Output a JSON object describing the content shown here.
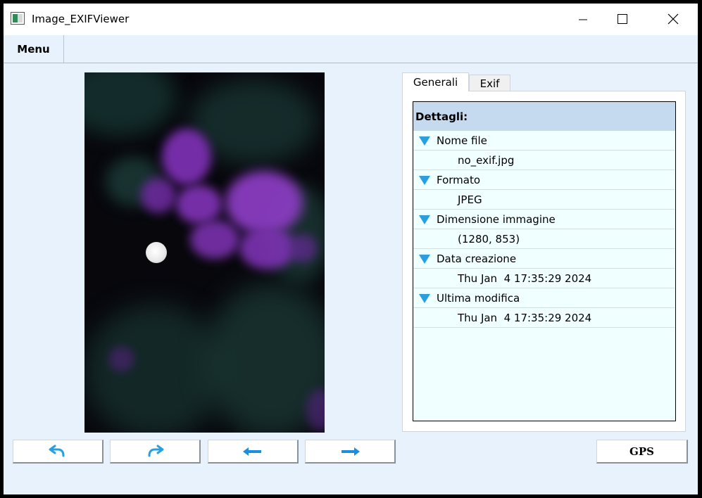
{
  "window": {
    "title": "Image_EXIFViewer"
  },
  "menubar": {
    "menu_label": "Menu"
  },
  "tabs": [
    {
      "label": "Generali"
    },
    {
      "label": "Exif"
    }
  ],
  "details": {
    "header": "Dettagli:",
    "items": [
      {
        "label": "Nome file",
        "value": "no_exif.jpg"
      },
      {
        "label": "Formato",
        "value": "JPEG"
      },
      {
        "label": "Dimensione immagine",
        "value": "(1280, 853)"
      },
      {
        "label": "Data creazione",
        "value": "Thu Jan  4 17:35:29 2024"
      },
      {
        "label": "Ultima modifica",
        "value": "Thu Jan  4 17:35:29 2024"
      }
    ]
  },
  "buttons": {
    "gps_label": "GPS"
  },
  "icons": {
    "app": "app-icon",
    "minimize": "minimize-icon",
    "maximize": "maximize-icon",
    "close": "close-icon",
    "undo": "undo-arrow-icon",
    "redo": "redo-arrow-icon",
    "prev": "left-arrow-icon",
    "next": "right-arrow-icon",
    "expanded": "triangle-down-icon"
  },
  "colors": {
    "accent": "#2a9fe0",
    "tree_bg": "#f0ffff",
    "tree_header": "#c5daef",
    "window_bg": "#e8f2fd"
  }
}
